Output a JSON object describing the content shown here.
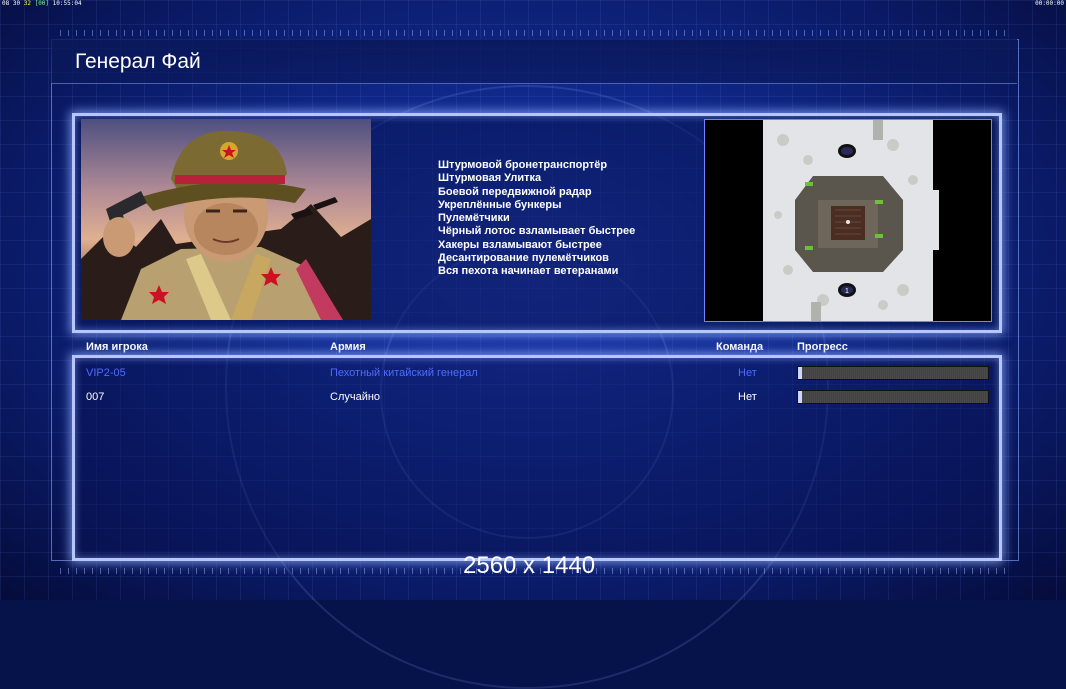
{
  "hud": {
    "left_segments": [
      {
        "text": "08",
        "color": "#ffffff"
      },
      {
        "text": "30",
        "color": "#ffffff"
      },
      {
        "text": "32",
        "color": "#ffff33"
      },
      {
        "text": "[00]",
        "color": "#77ff77"
      },
      {
        "text": "10:55:04",
        "color": "#ffffff"
      }
    ],
    "right": "00:00:00"
  },
  "header": {
    "title": "Генерал Фай"
  },
  "general": {
    "features": [
      "Штурмовой бронетранспортёр",
      "Штурмовая Улитка",
      "Боевой передвижной радар",
      "Укреплённые бункеры",
      "Пулемётчики",
      "Чёрный лотос взламывает быстрее",
      "Хакеры взламывают быстрее",
      "Десантирование пулемётчиков",
      "Вся пехота начинает ветеранами"
    ]
  },
  "minimap": {
    "start_marker": "1"
  },
  "table": {
    "headers": {
      "player": "Имя игрока",
      "army": "Армия",
      "team": "Команда",
      "progress": "Прогресс"
    },
    "rows": [
      {
        "player": "VIP2-05",
        "army": "Пехотный китайский генерал",
        "team": "Нет",
        "progress": 0.02,
        "is_self": true
      },
      {
        "player": "007",
        "army": "Случайно",
        "team": "Нет",
        "progress": 0.02,
        "is_self": false
      }
    ]
  },
  "overlay": {
    "resolution": "2560 x 1440"
  },
  "colors": {
    "accent": "#b8c6ff",
    "self_row": "#4f6bff",
    "background": "#0a1a66"
  }
}
